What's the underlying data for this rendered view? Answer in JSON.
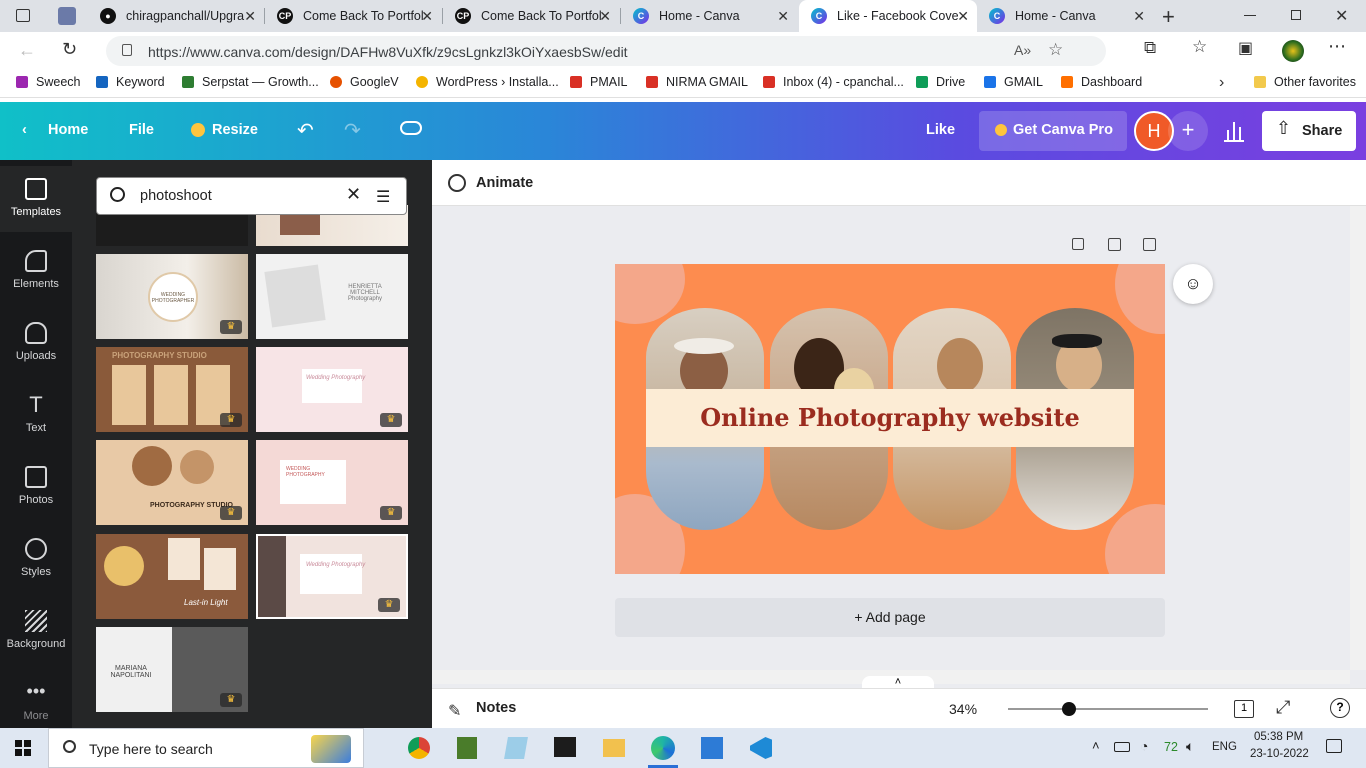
{
  "browser": {
    "tabs": [
      {
        "title": "chiragpanchall/Upgra",
        "icon": "github-icon"
      },
      {
        "title": "Come Back To Portfol",
        "icon": "cp-icon"
      },
      {
        "title": "Come Back To Portfol",
        "icon": "cp-icon"
      },
      {
        "title": "Home - Canva",
        "icon": "canva-icon"
      },
      {
        "title": "Like - Facebook Cove",
        "icon": "canva-icon",
        "active": true
      },
      {
        "title": "Home - Canva",
        "icon": "canva-icon"
      }
    ],
    "url": "https://www.canva.com/design/DAFHw8VuXfk/z9csLgnkzl3kOiYxaesbSw/edit",
    "bookmarks": [
      "Sweech",
      "Keyword",
      "Serpstat — Growth...",
      "GoogleV",
      "WordPress › Installa...",
      "PMAIL",
      "NIRMA GMAIL",
      "Inbox (4) - cpanchal...",
      "Drive",
      "GMAIL",
      "Dashboard"
    ],
    "other_favorites": "Other favorites"
  },
  "canva_header": {
    "home": "Home",
    "file": "File",
    "resize": "Resize",
    "title": "Like",
    "get_pro": "Get Canva Pro",
    "avatar_initial": "H",
    "share": "Share"
  },
  "rail": [
    {
      "label": "Templates",
      "icon": "templates-icon"
    },
    {
      "label": "Elements",
      "icon": "elements-icon"
    },
    {
      "label": "Uploads",
      "icon": "uploads-icon"
    },
    {
      "label": "Text",
      "icon": "text-icon"
    },
    {
      "label": "Photos",
      "icon": "photos-icon"
    },
    {
      "label": "Styles",
      "icon": "styles-icon"
    },
    {
      "label": "Background",
      "icon": "background-icon"
    },
    {
      "label": "More",
      "icon": "more-icon"
    }
  ],
  "panel": {
    "search_value": "photoshoot",
    "thumb_texts": {
      "t1": "WEDDING PHOTOGRAPHER",
      "t2": "HENRIETTA MITCHELL Photography",
      "t3": "PHOTOGRAPHY STUDIO",
      "t4": "Wedding Photography",
      "t5": "PHOTOGRAPHY STUDIO",
      "t6": "WEDDING PHOTOGRAPHY",
      "t7": "Last-in Light",
      "t8": "Wedding Photography",
      "t9": "MARIANA NAPOLITANI"
    }
  },
  "editor": {
    "animate": "Animate",
    "design_title": "Online Photography website",
    "add_page": "+ Add page",
    "notes": "Notes",
    "zoom": "34%",
    "page_count": "1",
    "zoom_fraction": 0.34
  },
  "taskbar": {
    "search_placeholder": "Type here to search",
    "temp": "72",
    "lang": "ENG",
    "time": "05:38 PM",
    "date": "23-10-2022"
  },
  "colors": {
    "design_bg": "#fd8c4f",
    "title_color": "#9b2c1f",
    "banner": "#fcecd5"
  }
}
